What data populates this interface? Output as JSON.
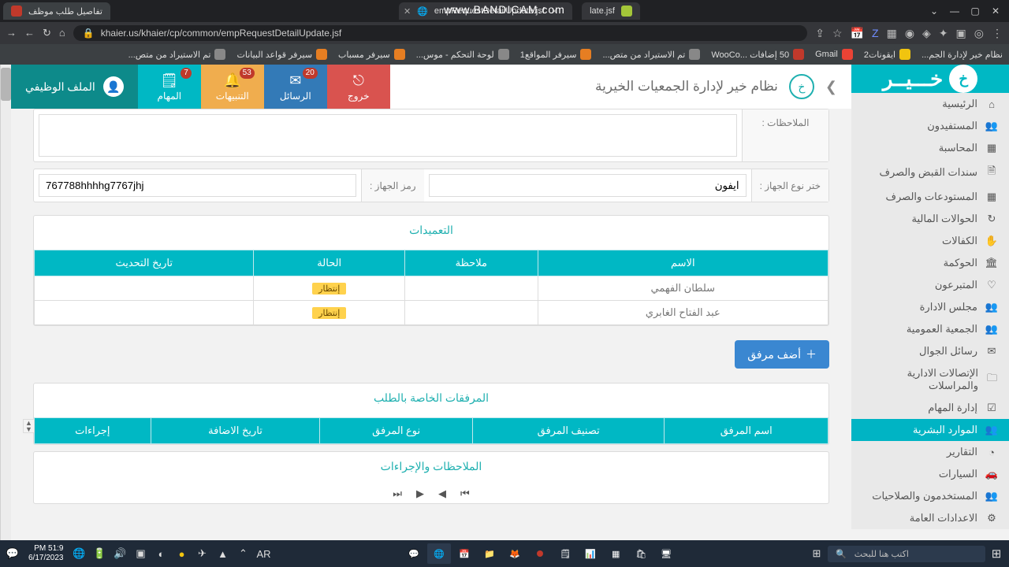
{
  "browser": {
    "watermark": "www.BANDICAM.com",
    "tabs": [
      {
        "title": "late.jsf"
      },
      {
        "title": "empRequestDetailUpdate.jsf"
      },
      {
        "title": "تفاصيل طلب موظف"
      }
    ],
    "url": "khaier.us/khaier/cp/common/empRequestDetailUpdate.jsf",
    "bookmarks": [
      "نظام خير لإدارة الجم...",
      "ايقونات2",
      "Gmail",
      "50 إضافات ...WooCo",
      "تم الاستيراد من متص...",
      "سيرفر المواقع1",
      "لوحة التحكم - موس...",
      "سيرفر مسباب",
      "سيرفر قواعد البيانات",
      "تم الاستيراد من متص..."
    ]
  },
  "header": {
    "brand": "خـــيــر",
    "system_title": "نظام خير لإدارة الجمعيات الخيرية",
    "actions": {
      "exit": "خروج",
      "messages": "الرسائل",
      "messages_count": "20",
      "alerts": "التنبيهات",
      "alerts_count": "53",
      "tasks": "المهام",
      "tasks_count": "7"
    },
    "profile": "الملف الوظيفي"
  },
  "sidebar": {
    "items": [
      {
        "label": "الرئيسية",
        "icon": "⌂"
      },
      {
        "label": "المستفيدون",
        "icon": "👥"
      },
      {
        "label": "المحاسبة",
        "icon": "▦"
      },
      {
        "label": "سندات القبض والصرف",
        "icon": "🗎"
      },
      {
        "label": "المستودعات والصرف",
        "icon": "▦"
      },
      {
        "label": "الحوالات المالية",
        "icon": "↻"
      },
      {
        "label": "الكفالات",
        "icon": "✋"
      },
      {
        "label": "الحوكمة",
        "icon": "🏛"
      },
      {
        "label": "المتبرعون",
        "icon": "♡"
      },
      {
        "label": "مجلس الادارة",
        "icon": "👥"
      },
      {
        "label": "الجمعية العمومية",
        "icon": "👥"
      },
      {
        "label": "رسائل الجوال",
        "icon": "✉"
      },
      {
        "label": "الإتصالات الادارية والمراسلات",
        "icon": "🗀"
      },
      {
        "label": "إدارة المهام",
        "icon": "☑"
      },
      {
        "label": "الموارد البشرية",
        "icon": "👥",
        "active": true
      },
      {
        "label": "التقارير",
        "icon": "◔"
      },
      {
        "label": "السيارات",
        "icon": "🚗"
      },
      {
        "label": "المستخدمون والصلاحيات",
        "icon": "👥"
      },
      {
        "label": "الاعدادات العامة",
        "icon": "⚙"
      }
    ]
  },
  "form": {
    "notes_label": "الملاحظات :",
    "notes_value": "",
    "device_type_label": "ختر نوع الجهاز :",
    "device_type_value": "ايفون",
    "device_code_label": "رمز الجهاز :",
    "device_code_value": "767788hhhhg7767jhj"
  },
  "approvals": {
    "title": "التعميدات",
    "cols": {
      "name": "الاسم",
      "note": "ملاحظة",
      "status": "الحالة",
      "updated": "تاريخ التحديث"
    },
    "status_wait": "إنتظار",
    "rows": [
      {
        "name": "سلطان الفهمي",
        "note": "",
        "status": "wait",
        "updated": ""
      },
      {
        "name": "عبد الفتاح الغابري",
        "note": "",
        "status": "wait",
        "updated": ""
      }
    ]
  },
  "attachments": {
    "add_button": "أضف مرفق",
    "title": "المرفقات الخاصة بالطلب",
    "cols": {
      "name": "اسم المرفق",
      "class": "تصنيف المرفق",
      "type": "نوع المرفق",
      "date": "تاريخ الاضافة",
      "actions": "إجراءات"
    }
  },
  "notes_panel": {
    "title": "الملاحظات والإجراءات"
  },
  "taskbar": {
    "time": "PM 51:9",
    "date": "6/17/2023",
    "lang": "AR",
    "rec_time": "",
    "search_placeholder": "اكتب هنا للبحث"
  }
}
